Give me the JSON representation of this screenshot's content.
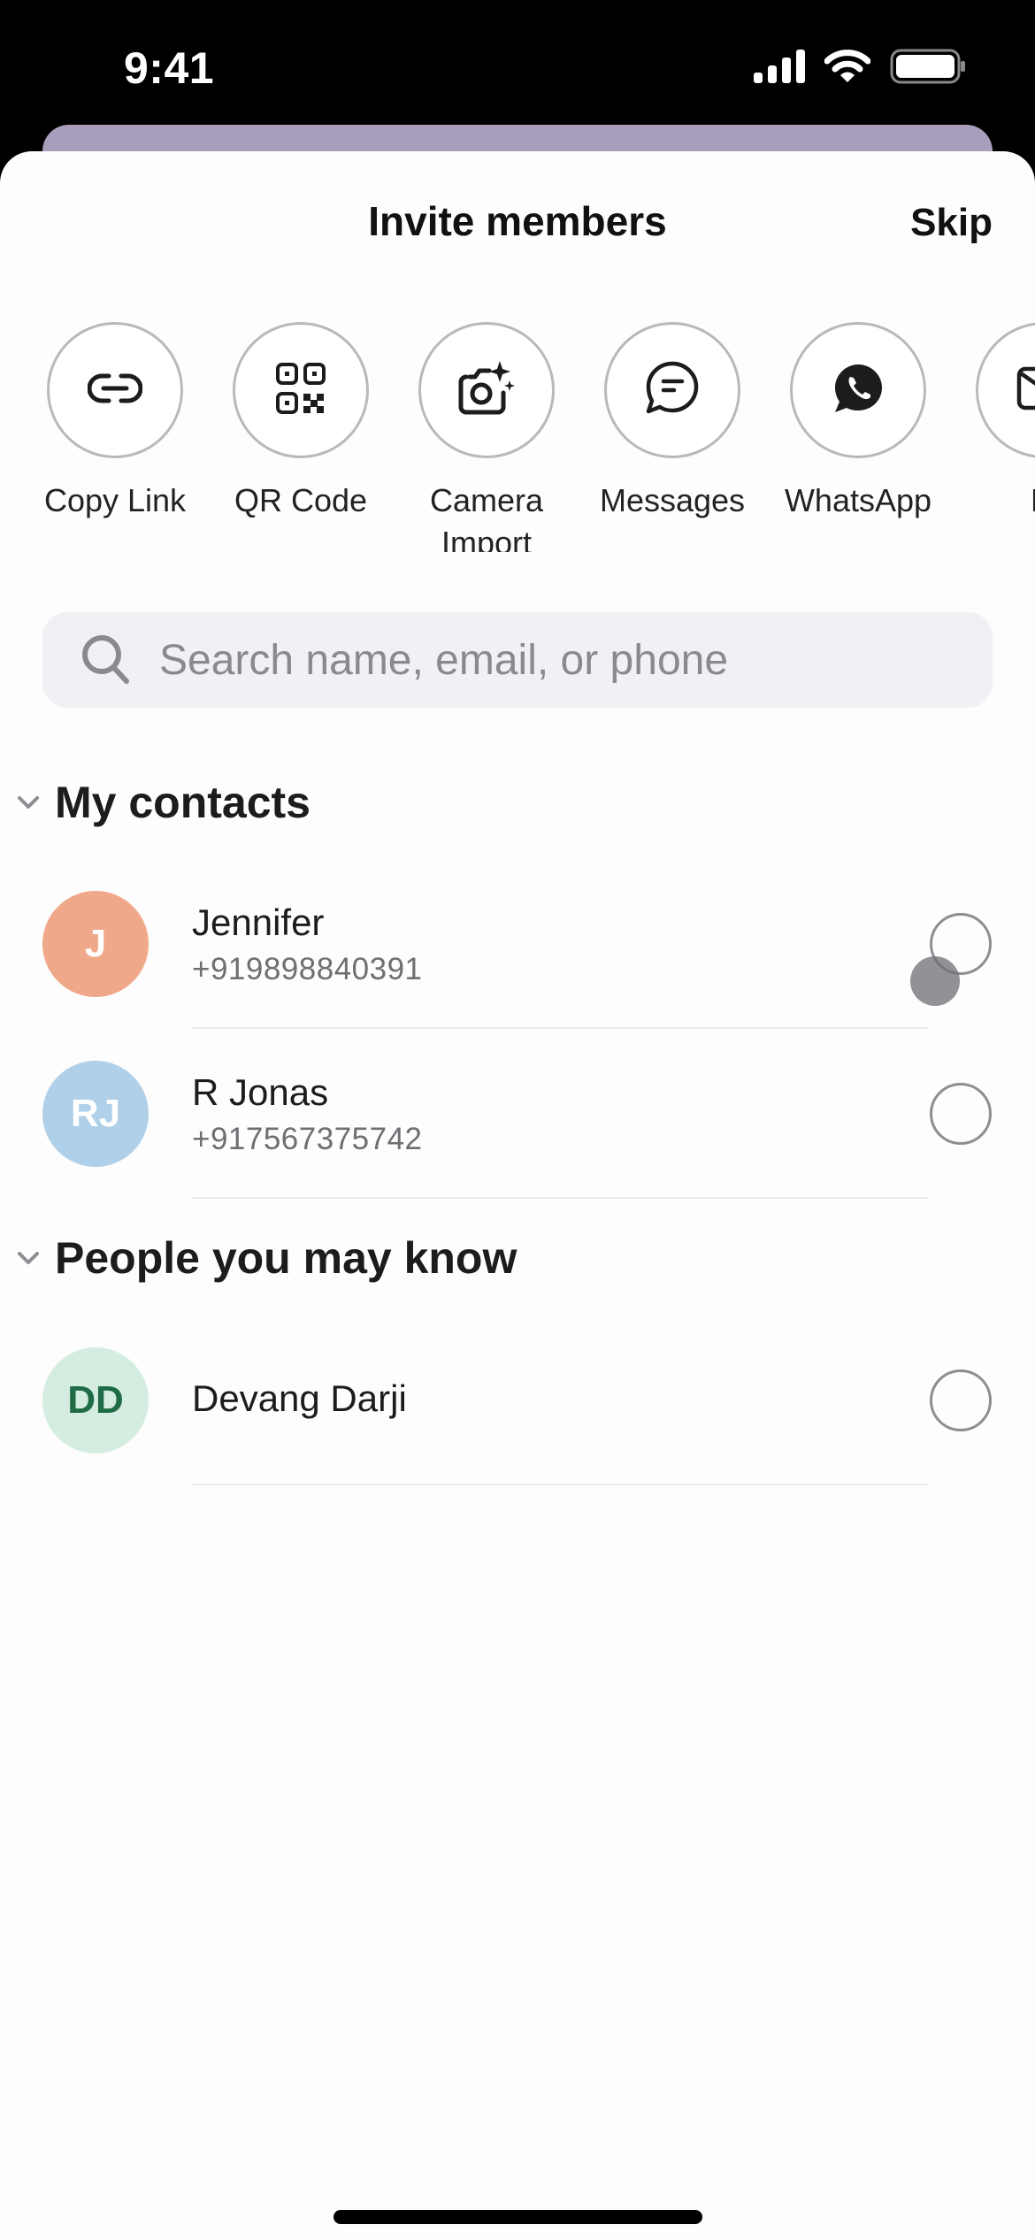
{
  "status_bar": {
    "time": "9:41",
    "icons": [
      "cellular-signal-icon",
      "wifi-icon",
      "battery-icon"
    ]
  },
  "sheet": {
    "title": "Invite members",
    "skip_label": "Skip"
  },
  "share_options": [
    {
      "label": "Copy Link",
      "icon": "link-icon"
    },
    {
      "label": "QR Code",
      "icon": "qr-code-icon"
    },
    {
      "label": "Camera\nImport",
      "icon": "camera-sparkle-icon"
    },
    {
      "label": "Messages",
      "icon": "message-bubble-icon"
    },
    {
      "label": "WhatsApp",
      "icon": "whatsapp-icon"
    },
    {
      "label": "M",
      "icon": "mail-icon"
    }
  ],
  "search": {
    "placeholder": "Search name, email, or phone",
    "value": ""
  },
  "sections": [
    {
      "title": "My contacts",
      "expanded": true,
      "contacts": [
        {
          "initials": "J",
          "name": "Jennifer",
          "phone": "+919898840391",
          "avatar_bg": "#EFA98A",
          "avatar_fg": "#FFFFFF",
          "selected": false
        },
        {
          "initials": "RJ",
          "name": "R Jonas",
          "phone": "+917567375742",
          "avatar_bg": "#AFD0E8",
          "avatar_fg": "#FFFFFF",
          "selected": false
        }
      ]
    },
    {
      "title": "People you may know",
      "expanded": true,
      "contacts": [
        {
          "initials": "DD",
          "name": "Devang Darji",
          "avatar_bg": "#D5EDE1",
          "avatar_fg": "#1F6B45",
          "selected": false
        }
      ]
    }
  ],
  "colors": {
    "background_card": "#A99DBC",
    "search_bg": "#F1F0F4",
    "radio_border": "#8E8E92"
  }
}
